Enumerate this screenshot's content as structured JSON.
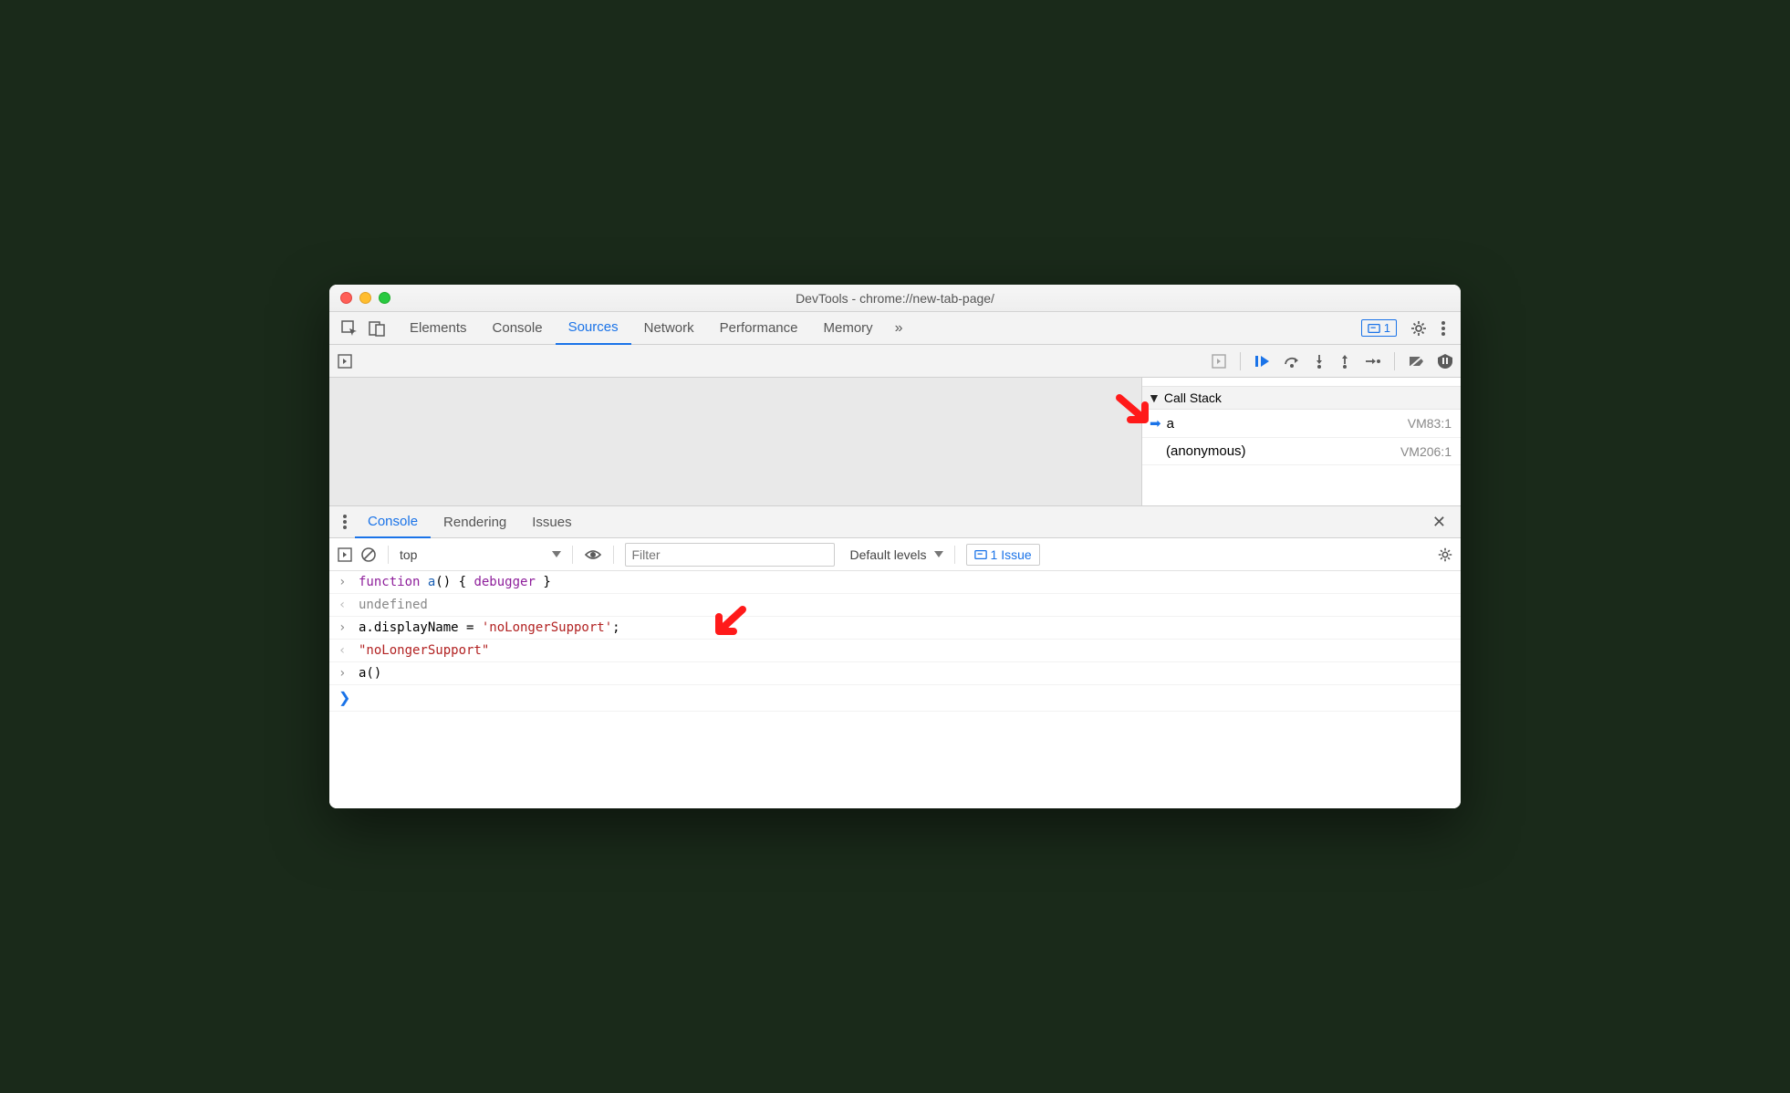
{
  "window": {
    "title": "DevTools - chrome://new-tab-page/"
  },
  "tabs": {
    "items": [
      "Elements",
      "Console",
      "Sources",
      "Network",
      "Performance",
      "Memory"
    ],
    "active": "Sources",
    "badge_count": "1"
  },
  "debugger": {
    "scope_partial_left": "",
    "scope_partial_right": "",
    "callstack_label": "Call Stack",
    "frames": [
      {
        "fn": "a",
        "loc": "VM83:1",
        "active": true
      },
      {
        "fn": "(anonymous)",
        "loc": "VM206:1",
        "active": false
      }
    ]
  },
  "drawer": {
    "tabs": [
      "Console",
      "Rendering",
      "Issues"
    ],
    "active": "Console"
  },
  "console_toolbar": {
    "context": "top",
    "filter_placeholder": "Filter",
    "levels": "Default levels",
    "issue_label": "1 Issue"
  },
  "console": {
    "lines": [
      {
        "type": "input",
        "segments": [
          {
            "t": "function ",
            "c": "kw"
          },
          {
            "t": "a",
            "c": "fn-name"
          },
          {
            "t": "() { ",
            "c": ""
          },
          {
            "t": "debugger",
            "c": "dbg"
          },
          {
            "t": " }",
            "c": ""
          }
        ]
      },
      {
        "type": "output",
        "segments": [
          {
            "t": "undefined",
            "c": "undef"
          }
        ]
      },
      {
        "type": "input",
        "segments": [
          {
            "t": "a.displayName = ",
            "c": ""
          },
          {
            "t": "'noLongerSupport'",
            "c": "str"
          },
          {
            "t": ";",
            "c": ""
          }
        ]
      },
      {
        "type": "output",
        "segments": [
          {
            "t": "\"noLongerSupport\"",
            "c": "result-str"
          }
        ]
      },
      {
        "type": "input",
        "segments": [
          {
            "t": "a()",
            "c": ""
          }
        ]
      }
    ]
  },
  "icons": {
    "more": "»",
    "close": "✕"
  }
}
